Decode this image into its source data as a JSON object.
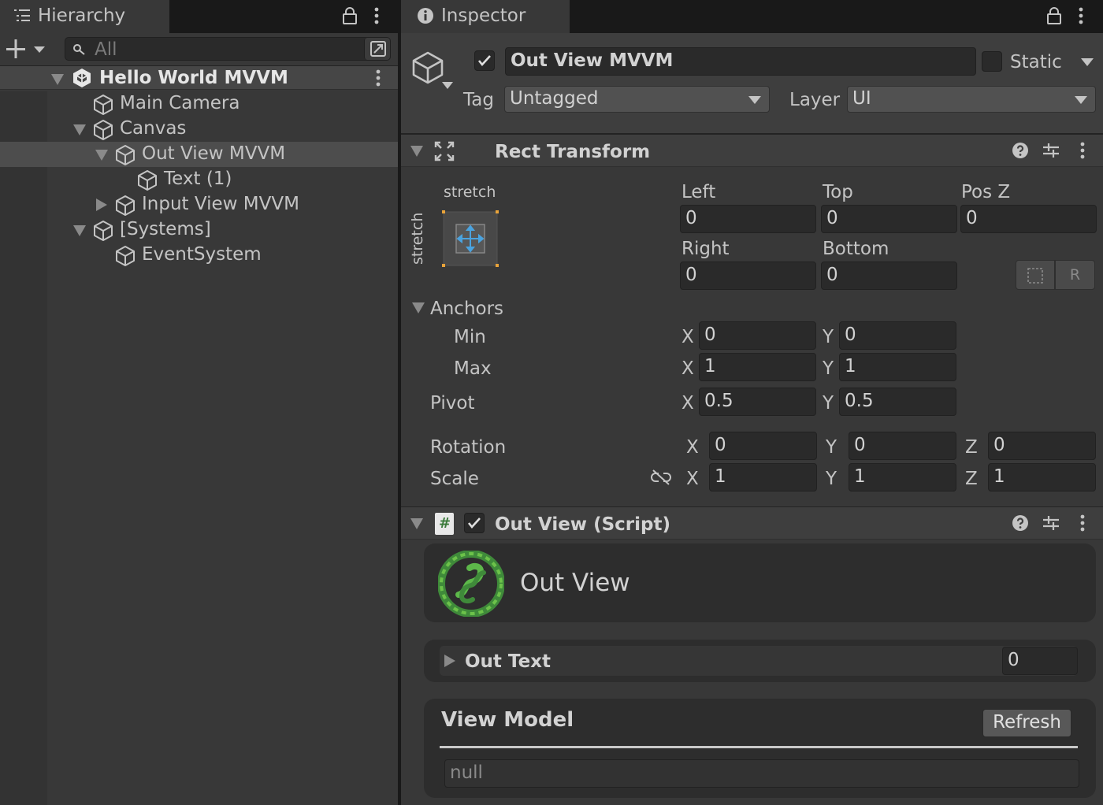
{
  "hierarchy": {
    "tab_title": "Hierarchy",
    "search_placeholder": "All",
    "scene": "Hello World MVVM",
    "items": [
      {
        "label": "Main Camera"
      },
      {
        "label": "Canvas"
      },
      {
        "label": "Out View MVVM"
      },
      {
        "label": "Text (1)"
      },
      {
        "label": "Input View MVVM"
      },
      {
        "label": "[Systems]"
      },
      {
        "label": "EventSystem"
      }
    ]
  },
  "inspector": {
    "tab_title": "Inspector",
    "object_name": "Out View MVVM",
    "static_label": "Static",
    "tag_label": "Tag",
    "tag_value": "Untagged",
    "layer_label": "Layer",
    "layer_value": "UI"
  },
  "rect_transform": {
    "title": "Rect Transform",
    "anchor_h": "stretch",
    "anchor_v": "stretch",
    "left_label": "Left",
    "left": "0",
    "top_label": "Top",
    "top": "0",
    "posz_label": "Pos Z",
    "posz": "0",
    "right_label": "Right",
    "right": "0",
    "bottom_label": "Bottom",
    "bottom": "0",
    "r_button": "R",
    "anchors_label": "Anchors",
    "min_label": "Min",
    "min_x": "0",
    "min_y": "0",
    "max_label": "Max",
    "max_x": "1",
    "max_y": "1",
    "pivot_label": "Pivot",
    "pivot_x": "0.5",
    "pivot_y": "0.5",
    "rotation_label": "Rotation",
    "rot_x": "0",
    "rot_y": "0",
    "rot_z": "0",
    "scale_label": "Scale",
    "scale_x": "1",
    "scale_y": "1",
    "scale_z": "1",
    "x": "X",
    "y": "Y",
    "z": "Z"
  },
  "script": {
    "title": "Out View (Script)",
    "hash": "#",
    "card_title": "Out View",
    "out_text_label": "Out Text",
    "out_text_value": "0",
    "view_model_label": "View Model",
    "refresh_label": "Refresh",
    "view_model_value": "null"
  },
  "colors": {
    "panel": "#383838",
    "tabbar": "#191919",
    "field": "#2a2a2a",
    "accent_anchor": "#e8a33a",
    "anchor_blue": "#4aa3df",
    "logo_green": "#4caf50"
  }
}
